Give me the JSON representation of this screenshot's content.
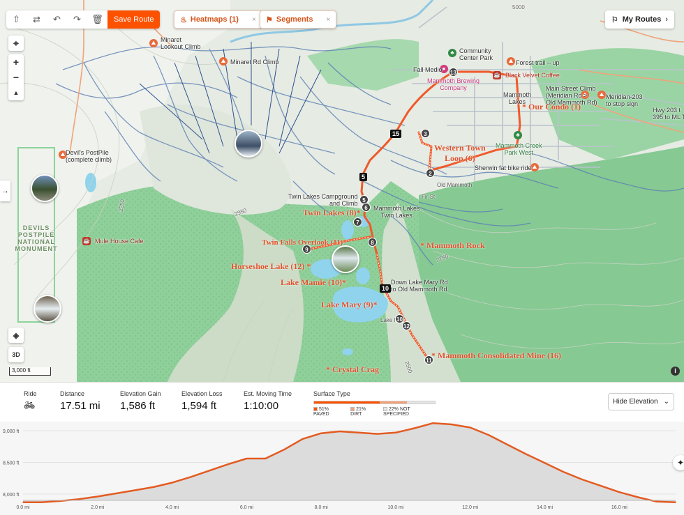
{
  "toolbar": {
    "save_label": "Save Route",
    "heatmaps_label": "Heatmaps (1)",
    "segments_label": "Segments",
    "close_glyph": "×",
    "my_routes_label": "My Routes",
    "chevron_glyph": "›"
  },
  "map_controls": {
    "zoom_in": "+",
    "zoom_out": "−",
    "three_d": "3D",
    "scale": "3,000 ft",
    "info": "i"
  },
  "map_labels": {
    "minaret_lookout": "Minaret\nLookout Climb",
    "minaret_rd": "Minaret Rd Climb",
    "community_center": "Community\nCenter Park",
    "forest_trail": "Forest trail – up",
    "fall_medio": "Fall Medio",
    "mammoth_brewing": "Mammoth Brewing\nCompany",
    "black_velvet": "Black Velvet Coffee",
    "main_street": "Main Street Climb\n(Meridian Rd >\nOld Mammoth Rd)",
    "meridian_203": "Meridian-203\nto stop sign",
    "hwy_203": "Hwy 203 t\n395 to ML T",
    "mammoth_lakes": "Mammoth\nLakes",
    "mammoth_creek": "Mammoth Creek\nPark West",
    "sherwin": "Sherwin fat bike ride",
    "old_mammoth": "Old Mammoth",
    "fir_st": "Fir St",
    "devils_postpile": "Devil's PostPile\n(complete climb)",
    "devils_monument": "DEVILS\nPOSTPILE\nNATIONAL\nMONUMENT",
    "mule_house": "Mule House Cafe",
    "twin_lakes_cg": "Twin Lakes Campground\nand Climb",
    "mammoth_twin": "Mammoth Lakes\nTwin Lakes",
    "down_lake_mary": "Down Lake Mary Rd\nto Old Mammoth Rd",
    "lake_m": "Lake M",
    "contour_2250": "2250",
    "contour_2750": "2750",
    "contour_2500": "2500",
    "contour_2950": "2950",
    "contour_5000": "5000"
  },
  "annotations": {
    "our_condo": "* Our Condo (1)",
    "western_town": "Western Town\nLoop (6)",
    "twin_lakes": "Twin Lakes (8)*",
    "twin_falls": "Twin Falls Overlook (11)*",
    "mammoth_rock": "* Mammoth Rock",
    "horseshoe": "Horseshoe Lake (12) *",
    "lake_mamie": "Lake Mamie (10)*",
    "lake_mary": "Lake Mary (9)*",
    "consolidated": "* Mammoth Consolidated Mine (16)",
    "crystal_crag": "* Crystal Crag"
  },
  "route_stops": [
    "2",
    "3",
    "5",
    "6",
    "7",
    "8",
    "9",
    "10",
    "11",
    "12",
    "13"
  ],
  "flags": {
    "f15": "15",
    "f5": "5",
    "f10": "10"
  },
  "stats": {
    "ride_label": "Ride",
    "distance_label": "Distance",
    "distance_value": "17.51 mi",
    "gain_label": "Elevation Gain",
    "gain_value": "1,586 ft",
    "loss_label": "Elevation Loss",
    "loss_value": "1,594 ft",
    "time_label": "Est. Moving Time",
    "time_value": "1:10:00",
    "surface_label": "Surface Type",
    "surface": [
      {
        "label": "51% PAVED",
        "pct": 51,
        "color": "#fc5200"
      },
      {
        "label": "21% DIRT",
        "pct": 21,
        "color": "#f3a37a"
      },
      {
        "label": "22% NOT SPECIFIED",
        "pct": 22,
        "color": "#e6e6e6"
      }
    ],
    "hide_elevation": "Hide Elevation"
  },
  "chart_data": {
    "type": "area",
    "x_unit": "mi",
    "y_unit": "ft",
    "xlim": [
      0,
      17.51
    ],
    "ylim": [
      7900,
      9100
    ],
    "x_ticks": [
      "0.0 mi",
      "2.0 mi",
      "4.0 mi",
      "6.0 mi",
      "8.0 mi",
      "10.0 mi",
      "12.0 mi",
      "14.0 mi",
      "16.0 mi"
    ],
    "y_ticks": [
      "9,000 ft",
      "8,500 ft",
      "8,000 ft"
    ],
    "x": [
      0,
      0.5,
      1,
      1.5,
      2,
      2.5,
      3,
      3.5,
      4,
      4.5,
      5,
      5.5,
      6,
      6.5,
      7,
      7.5,
      8,
      8.5,
      9,
      9.5,
      10,
      10.5,
      11,
      11.5,
      12,
      12.5,
      13,
      13.5,
      14,
      14.5,
      15,
      15.5,
      16,
      16.5,
      17,
      17.51
    ],
    "y": [
      7870,
      7870,
      7890,
      7920,
      7960,
      8010,
      8060,
      8110,
      8180,
      8270,
      8370,
      8470,
      8560,
      8560,
      8700,
      8870,
      8960,
      8990,
      8970,
      8950,
      8970,
      9040,
      9120,
      9100,
      9050,
      8930,
      8780,
      8630,
      8490,
      8350,
      8230,
      8130,
      8030,
      7950,
      7880,
      7870
    ]
  }
}
